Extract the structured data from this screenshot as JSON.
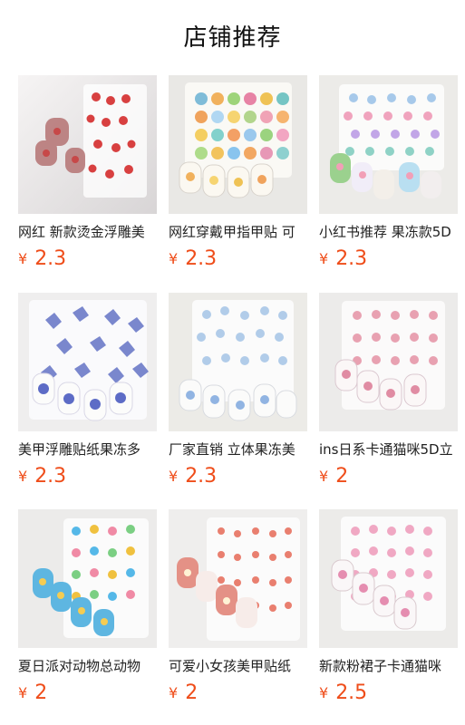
{
  "page": {
    "title": "店铺推荐"
  },
  "products": [
    {
      "name": "网红 新款烫金浮雕美",
      "currency": "¥",
      "price": "2.3",
      "image_theme": "red-rose-stickers",
      "accent": "#d84040"
    },
    {
      "name": "网红穿戴甲指甲贴 可",
      "currency": "¥",
      "price": "2.3",
      "image_theme": "smiley-face-stickers",
      "accent": "#f0a35c"
    },
    {
      "name": "小红书推荐 果冻款5D",
      "currency": "¥",
      "price": "2.3",
      "image_theme": "jelly-flower-stickers",
      "accent": "#8cc7e8"
    },
    {
      "name": "美甲浮雕贴纸果冻多",
      "currency": "¥",
      "price": "2.3",
      "image_theme": "blue-butterfly-stickers",
      "accent": "#6d7bc9"
    },
    {
      "name": "厂家直销 立体果冻美",
      "currency": "¥",
      "price": "2.3",
      "image_theme": "jelly-bunny-stickers",
      "accent": "#a9c8e8"
    },
    {
      "name": "ins日系卡通猫咪5D立",
      "currency": "¥",
      "price": "2",
      "image_theme": "cartoon-cat-stickers",
      "accent": "#e8a1b1"
    },
    {
      "name": "夏日派对动物总动物",
      "currency": "¥",
      "price": "2",
      "image_theme": "animal-party-stickers",
      "accent": "#55b8e8"
    },
    {
      "name": "可爱小女孩美甲贴纸",
      "currency": "¥",
      "price": "2",
      "image_theme": "little-girl-stickers",
      "accent": "#e97f6f"
    },
    {
      "name": "新款粉裙子卡通猫咪",
      "currency": "¥",
      "price": "2.5",
      "image_theme": "pink-dress-cat-stickers",
      "accent": "#f0a8c3"
    }
  ],
  "colors": {
    "price": "#ef4d1a",
    "text": "#222222",
    "background": "#ffffff"
  }
}
